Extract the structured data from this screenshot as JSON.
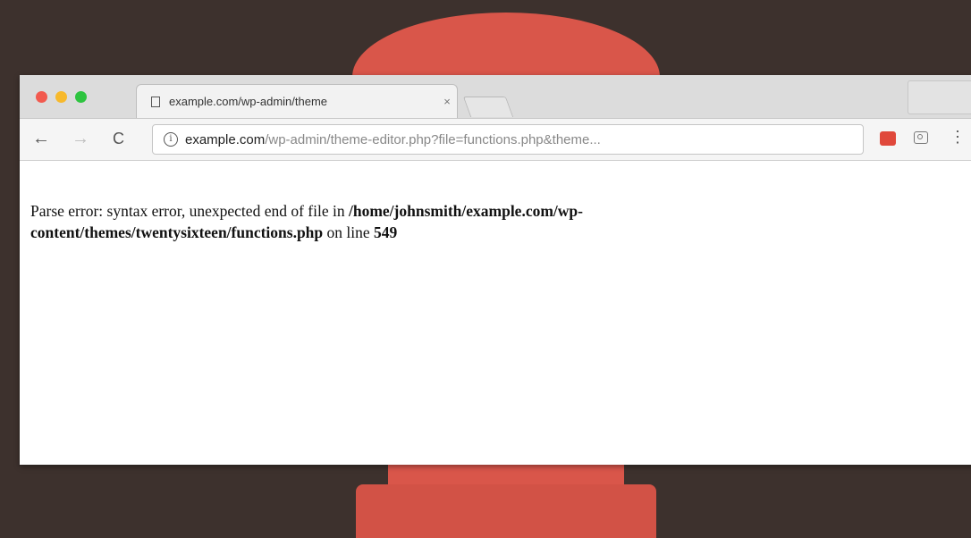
{
  "tab": {
    "title": "example.com/wp-admin/theme",
    "close": "×"
  },
  "toolbar": {
    "back": "←",
    "forward": "→",
    "reload": "C",
    "info": "i",
    "menu": "⋮"
  },
  "address_bar": {
    "host": "example.com",
    "path": "/wp-admin/theme-editor.php?file=functions.php&theme..."
  },
  "page": {
    "error_prefix": "Parse error",
    "error_message": ": syntax error, unexpected end of file in ",
    "file_path": "/home/johnsmith/example.com/wp-content/themes/twentysixteen/functions.php",
    "line_text": " on line ",
    "line_number": "549"
  },
  "colors": {
    "background": "#3d312d",
    "accent_red": "#d9564a"
  }
}
